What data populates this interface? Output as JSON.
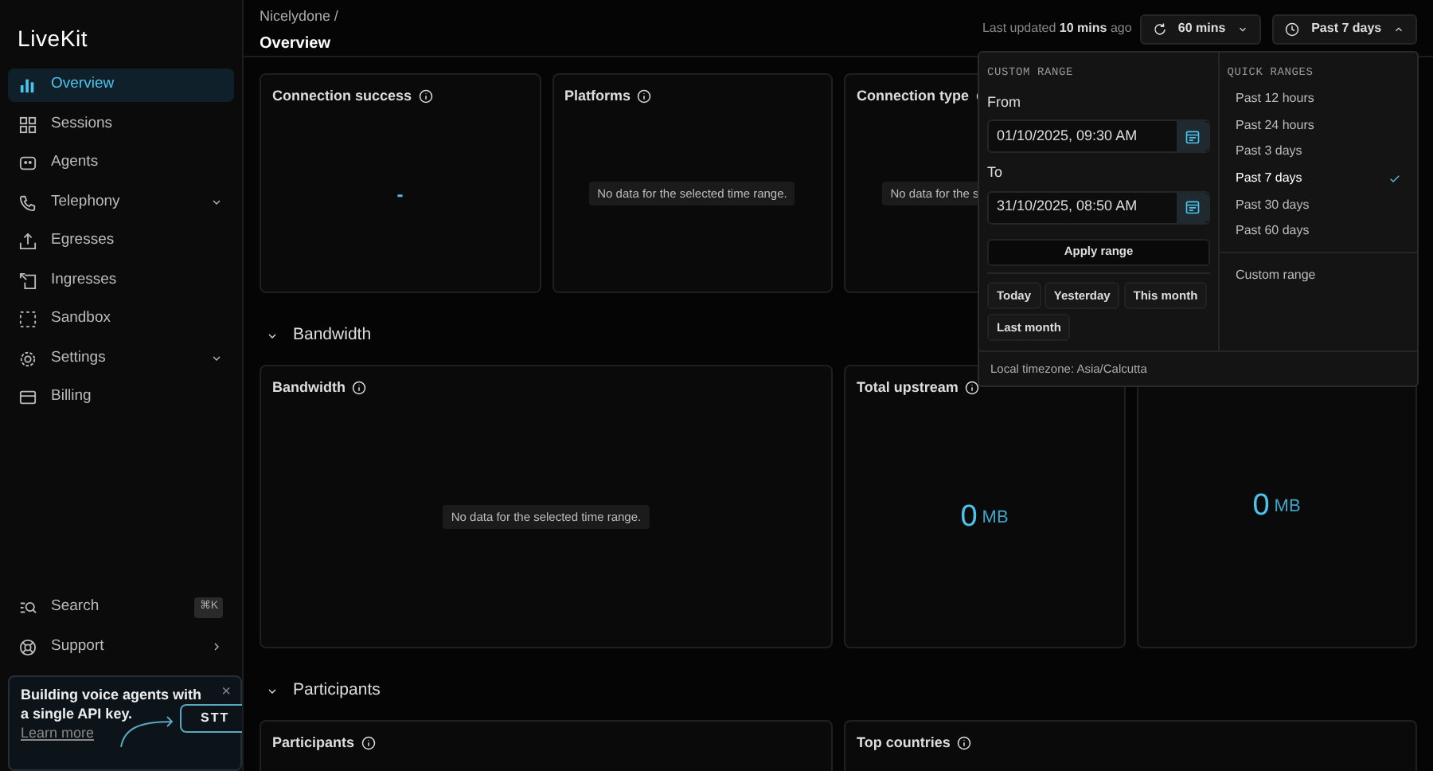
{
  "sidebar": {
    "logo": "LiveKit",
    "items": [
      {
        "label": "Overview",
        "selected": true,
        "kind": "link"
      },
      {
        "label": "Sessions",
        "selected": false,
        "kind": "link"
      },
      {
        "label": "Agents",
        "selected": false,
        "kind": "link"
      },
      {
        "label": "Telephony",
        "selected": false,
        "kind": "group"
      },
      {
        "label": "Egresses",
        "selected": false,
        "kind": "link"
      },
      {
        "label": "Ingresses",
        "selected": false,
        "kind": "link"
      },
      {
        "label": "Sandbox",
        "selected": false,
        "kind": "link"
      },
      {
        "label": "Settings",
        "selected": false,
        "kind": "group"
      },
      {
        "label": "Billing",
        "selected": false,
        "kind": "link"
      }
    ],
    "search": {
      "label": "Search",
      "shortcut": "⌘K"
    },
    "support": {
      "label": "Support"
    },
    "promo": {
      "text": "Building voice agents with a single API key.",
      "link": "Learn more",
      "close": "×",
      "button": "STT"
    }
  },
  "header": {
    "breadcrumb": "Nicelydone",
    "separator": "/",
    "title": "Overview",
    "last_updated": "Last updated **10 mins** ago",
    "refresh": "60 mins",
    "range": "Past 7 days",
    "range_expanded": true
  },
  "range_menu": {
    "custom_label": "CUSTOM RANGE",
    "from_label": "From",
    "from_value": "01/10/2025, 09:30 AM",
    "to_label": "To",
    "to_value": "31/10/2025, 08:50 AM",
    "apply": "Apply range",
    "presets": [
      "Today",
      "Yesterday",
      "This month",
      "Last month"
    ],
    "quick_label": "QUICK RANGES",
    "quick": [
      {
        "label": "Past 12 hours",
        "selected": false
      },
      {
        "label": "Past 24 hours",
        "selected": false
      },
      {
        "label": "Past 3 days",
        "selected": false
      },
      {
        "label": "Past 7 days",
        "selected": true
      },
      {
        "label": "Past 30 days",
        "selected": false
      },
      {
        "label": "Past 60 days",
        "selected": false
      }
    ],
    "custom": "Custom range",
    "timezone": "Local timezone: Asia/Calcutta"
  },
  "sections": [
    {
      "cards": [
        {
          "title": "Connection success",
          "kind": "dash",
          "value": "-"
        },
        {
          "title": "Platforms",
          "kind": "empty",
          "message": "No data for the selected time range."
        },
        {
          "title": "Connection type",
          "kind": "empty",
          "message": "No data for the s"
        }
      ]
    },
    {
      "title": "Bandwidth",
      "expanded": true,
      "cards": [
        {
          "title": "Bandwidth",
          "kind": "empty",
          "message": "No data for the selected time range.",
          "wide": true
        },
        {
          "title": "Total upstream",
          "kind": "total",
          "value": "0",
          "unit": "MB"
        },
        {
          "kind": "total",
          "value": "0",
          "unit": "MB"
        }
      ]
    },
    {
      "title": "Participants",
      "expanded": true,
      "cards": [
        {
          "title": "Participants",
          "kind": "empty",
          "wide": true
        },
        {
          "title": "Top countries",
          "kind": "empty",
          "wide": true
        }
      ]
    }
  ]
}
